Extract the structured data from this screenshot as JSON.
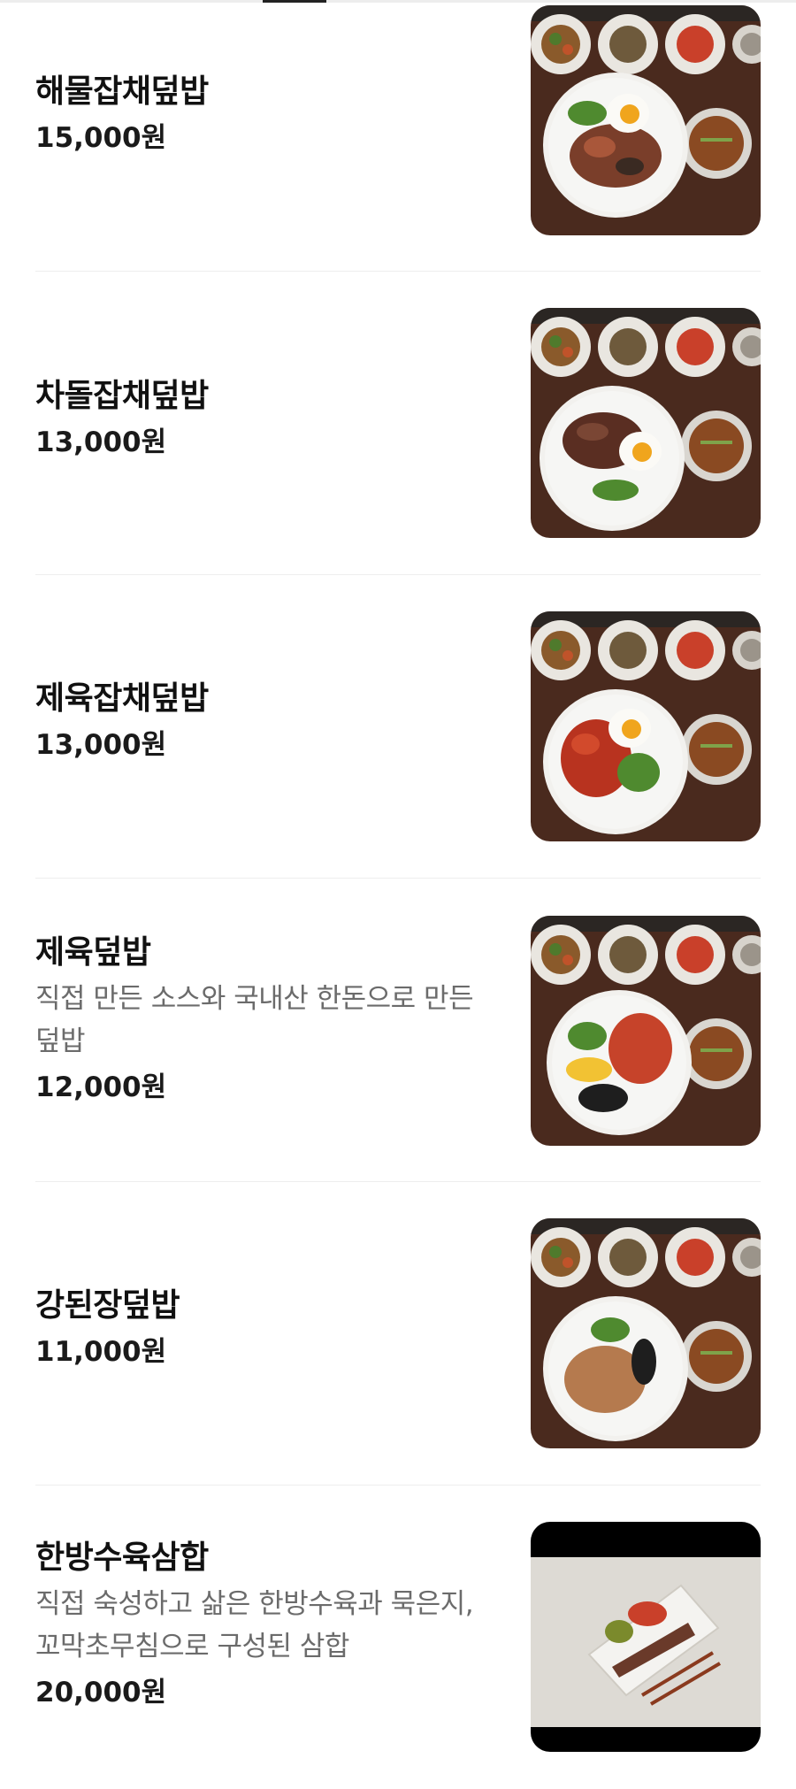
{
  "menu": {
    "items": [
      {
        "name": "해물잡채덮밥",
        "description": "",
        "price": "15,000원",
        "photo": "seafood-japchae-rice-bowl-photo",
        "topping": "seafood"
      },
      {
        "name": "차돌잡채덮밥",
        "description": "",
        "price": "13,000원",
        "photo": "beef-brisket-japchae-rice-bowl-photo",
        "topping": "brisket"
      },
      {
        "name": "제육잡채덮밥",
        "description": "",
        "price": "13,000원",
        "photo": "spicy-pork-japchae-rice-bowl-photo",
        "topping": "spicy-pork"
      },
      {
        "name": "제육덮밥",
        "description": "직접 만든 소스와 국내산 한돈으로 만든 덮밥",
        "price": "12,000원",
        "photo": "spicy-pork-rice-bowl-photo",
        "topping": "spicy-pork-bibim"
      },
      {
        "name": "강된장덮밥",
        "description": "",
        "price": "11,000원",
        "photo": "soybean-paste-rice-bowl-photo",
        "topping": "doenjang"
      },
      {
        "name": "한방수육삼합",
        "description": "직접 숙성하고 삶은 한방수육과 묵은지, 꼬막초무침으로 구성된 삼합",
        "price": "20,000원",
        "photo": "herbal-boiled-pork-samhap-photo",
        "topping": "samhap"
      }
    ]
  },
  "colors": {
    "tray": "#4a2a1e",
    "plate": "#f2f1ee",
    "text_primary": "#111111",
    "text_secondary": "#6b6b6b",
    "divider": "#eeeeee"
  }
}
